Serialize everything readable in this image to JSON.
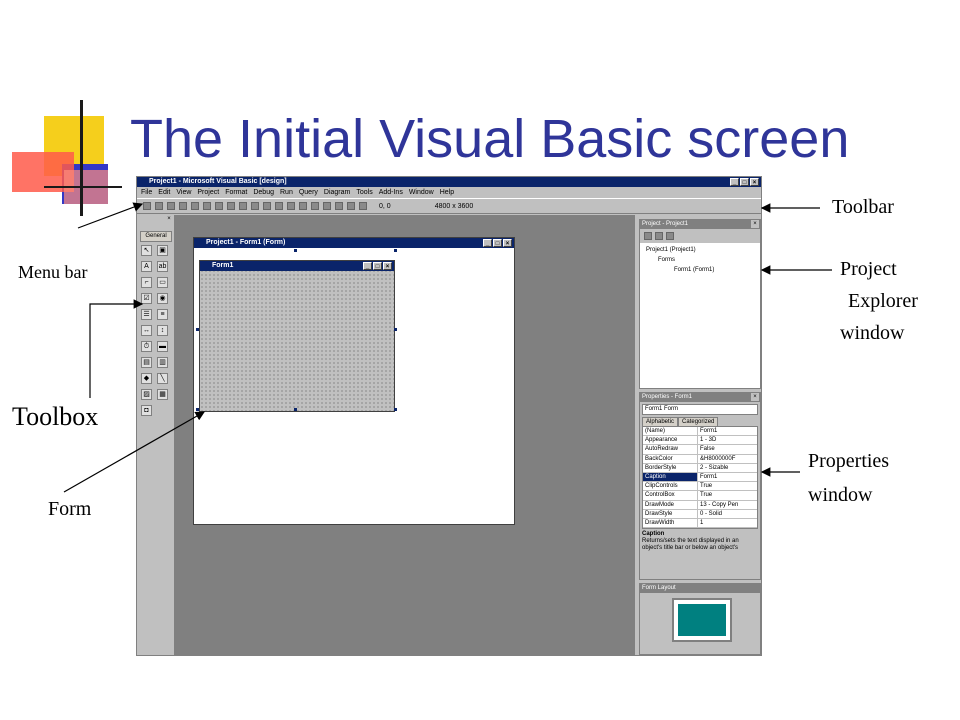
{
  "slide": {
    "title": "The Initial Visual Basic screen"
  },
  "vb": {
    "main_title": "Project1 - Microsoft Visual Basic [design]",
    "menu": [
      "File",
      "Edit",
      "View",
      "Project",
      "Format",
      "Debug",
      "Run",
      "Query",
      "Diagram",
      "Tools",
      "Add-Ins",
      "Window",
      "Help"
    ],
    "toolbar_pos": "0, 0",
    "toolbar_size": "4800 x 3600",
    "toolbox_tab": "General",
    "form_window_title": "Project1 - Form1 (Form)",
    "form_title": "Form1",
    "project_title": "Project - Project1",
    "project_tree": [
      "Project1 (Project1)",
      "Forms",
      "Form1 (Form1)"
    ],
    "props_title": "Properties - Form1",
    "props_combo": "Form1  Form",
    "props_tabs": [
      "Alphabetic",
      "Categorized"
    ],
    "props_rows": [
      {
        "k": "(Name)",
        "v": "Form1"
      },
      {
        "k": "Appearance",
        "v": "1 - 3D"
      },
      {
        "k": "AutoRedraw",
        "v": "False"
      },
      {
        "k": "BackColor",
        "v": "&H8000000F"
      },
      {
        "k": "BorderStyle",
        "v": "2 - Sizable"
      },
      {
        "k": "Caption",
        "v": "Form1"
      },
      {
        "k": "ClipControls",
        "v": "True"
      },
      {
        "k": "ControlBox",
        "v": "True"
      },
      {
        "k": "DrawMode",
        "v": "13 - Copy Pen"
      },
      {
        "k": "DrawStyle",
        "v": "0 - Solid"
      },
      {
        "k": "DrawWidth",
        "v": "1"
      }
    ],
    "props_desc_title": "Caption",
    "props_desc": "Returns/sets the text displayed in an object's title bar or below an object's",
    "layout_title": "Form Layout"
  },
  "labels": {
    "toolbar": "Toolbar",
    "menu_bar": "Menu bar",
    "project_explorer": [
      "Project",
      "Explorer",
      "window"
    ],
    "toolbox": "Toolbox",
    "properties": [
      "Properties",
      "window"
    ],
    "form": "Form"
  },
  "colors": {
    "title_blue": "#2f3599",
    "vb_title_bar": "#0a246a",
    "workspace": "#808080"
  }
}
